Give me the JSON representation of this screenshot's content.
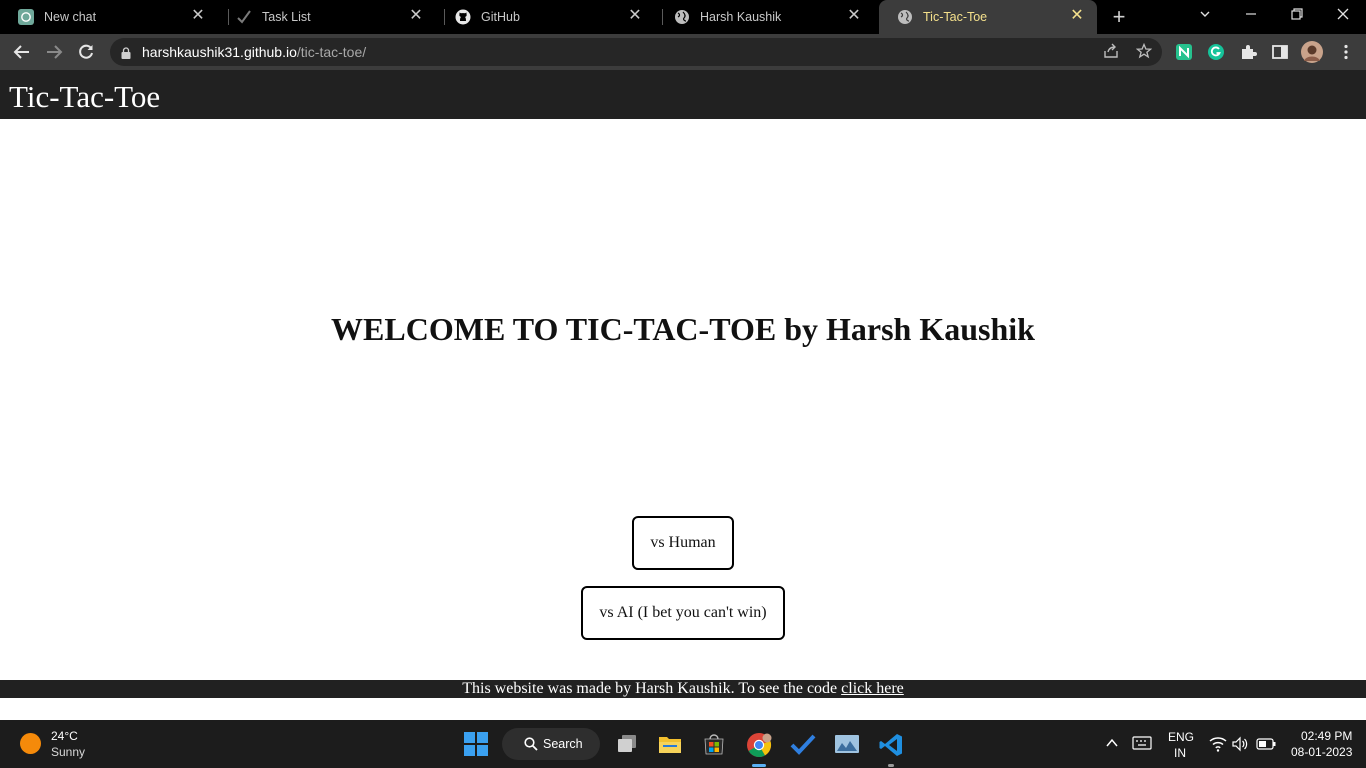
{
  "browser": {
    "tabs": [
      {
        "title": "New chat",
        "icon": "chatgpt-icon"
      },
      {
        "title": "Task List",
        "icon": "checkmark-icon"
      },
      {
        "title": "GitHub",
        "icon": "github-icon"
      },
      {
        "title": "Harsh Kaushik",
        "icon": "globe-icon"
      },
      {
        "title": "Tic-Tac-Toe",
        "icon": "globe-icon",
        "active": true
      }
    ],
    "url_host": "harshkaushik31.github.io",
    "url_path": "/tic-tac-toe/"
  },
  "page": {
    "header_title": "Tic-Tac-Toe",
    "welcome_heading": "WELCOME TO TIC-TAC-TOE by Harsh Kaushik",
    "buttons": {
      "vs_human": "vs Human",
      "vs_ai": "vs AI (I bet you can't win)"
    },
    "footer": {
      "text": "This website was made by Harsh Kaushik. To see the code",
      "link_text": "click here"
    }
  },
  "taskbar": {
    "weather_temp": "24°C",
    "weather_condition": "Sunny",
    "search_label": "Search",
    "language": "ENG",
    "region": "IN",
    "time": "02:49 PM",
    "date": "08-01-2023"
  },
  "colors": {
    "tabstrip": "#000000",
    "toolbar": "#3c3c3c",
    "active_tab_text": "#f4e08c",
    "site_header": "#212121",
    "taskbar": "#1c1c1c"
  }
}
